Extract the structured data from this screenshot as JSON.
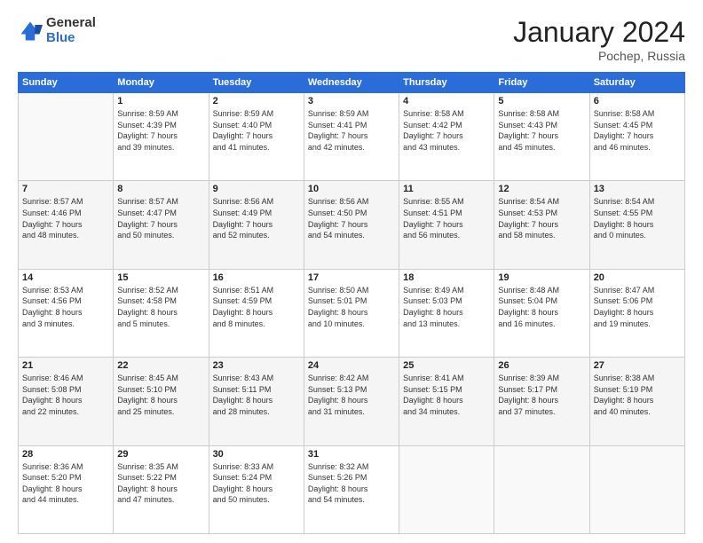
{
  "logo": {
    "general": "General",
    "blue": "Blue"
  },
  "title": {
    "month": "January 2024",
    "location": "Pochep, Russia"
  },
  "weekdays": [
    "Sunday",
    "Monday",
    "Tuesday",
    "Wednesday",
    "Thursday",
    "Friday",
    "Saturday"
  ],
  "weeks": [
    [
      {
        "day": "",
        "info": ""
      },
      {
        "day": "1",
        "info": "Sunrise: 8:59 AM\nSunset: 4:39 PM\nDaylight: 7 hours\nand 39 minutes."
      },
      {
        "day": "2",
        "info": "Sunrise: 8:59 AM\nSunset: 4:40 PM\nDaylight: 7 hours\nand 41 minutes."
      },
      {
        "day": "3",
        "info": "Sunrise: 8:59 AM\nSunset: 4:41 PM\nDaylight: 7 hours\nand 42 minutes."
      },
      {
        "day": "4",
        "info": "Sunrise: 8:58 AM\nSunset: 4:42 PM\nDaylight: 7 hours\nand 43 minutes."
      },
      {
        "day": "5",
        "info": "Sunrise: 8:58 AM\nSunset: 4:43 PM\nDaylight: 7 hours\nand 45 minutes."
      },
      {
        "day": "6",
        "info": "Sunrise: 8:58 AM\nSunset: 4:45 PM\nDaylight: 7 hours\nand 46 minutes."
      }
    ],
    [
      {
        "day": "7",
        "info": "Sunrise: 8:57 AM\nSunset: 4:46 PM\nDaylight: 7 hours\nand 48 minutes."
      },
      {
        "day": "8",
        "info": "Sunrise: 8:57 AM\nSunset: 4:47 PM\nDaylight: 7 hours\nand 50 minutes."
      },
      {
        "day": "9",
        "info": "Sunrise: 8:56 AM\nSunset: 4:49 PM\nDaylight: 7 hours\nand 52 minutes."
      },
      {
        "day": "10",
        "info": "Sunrise: 8:56 AM\nSunset: 4:50 PM\nDaylight: 7 hours\nand 54 minutes."
      },
      {
        "day": "11",
        "info": "Sunrise: 8:55 AM\nSunset: 4:51 PM\nDaylight: 7 hours\nand 56 minutes."
      },
      {
        "day": "12",
        "info": "Sunrise: 8:54 AM\nSunset: 4:53 PM\nDaylight: 7 hours\nand 58 minutes."
      },
      {
        "day": "13",
        "info": "Sunrise: 8:54 AM\nSunset: 4:55 PM\nDaylight: 8 hours\nand 0 minutes."
      }
    ],
    [
      {
        "day": "14",
        "info": "Sunrise: 8:53 AM\nSunset: 4:56 PM\nDaylight: 8 hours\nand 3 minutes."
      },
      {
        "day": "15",
        "info": "Sunrise: 8:52 AM\nSunset: 4:58 PM\nDaylight: 8 hours\nand 5 minutes."
      },
      {
        "day": "16",
        "info": "Sunrise: 8:51 AM\nSunset: 4:59 PM\nDaylight: 8 hours\nand 8 minutes."
      },
      {
        "day": "17",
        "info": "Sunrise: 8:50 AM\nSunset: 5:01 PM\nDaylight: 8 hours\nand 10 minutes."
      },
      {
        "day": "18",
        "info": "Sunrise: 8:49 AM\nSunset: 5:03 PM\nDaylight: 8 hours\nand 13 minutes."
      },
      {
        "day": "19",
        "info": "Sunrise: 8:48 AM\nSunset: 5:04 PM\nDaylight: 8 hours\nand 16 minutes."
      },
      {
        "day": "20",
        "info": "Sunrise: 8:47 AM\nSunset: 5:06 PM\nDaylight: 8 hours\nand 19 minutes."
      }
    ],
    [
      {
        "day": "21",
        "info": "Sunrise: 8:46 AM\nSunset: 5:08 PM\nDaylight: 8 hours\nand 22 minutes."
      },
      {
        "day": "22",
        "info": "Sunrise: 8:45 AM\nSunset: 5:10 PM\nDaylight: 8 hours\nand 25 minutes."
      },
      {
        "day": "23",
        "info": "Sunrise: 8:43 AM\nSunset: 5:11 PM\nDaylight: 8 hours\nand 28 minutes."
      },
      {
        "day": "24",
        "info": "Sunrise: 8:42 AM\nSunset: 5:13 PM\nDaylight: 8 hours\nand 31 minutes."
      },
      {
        "day": "25",
        "info": "Sunrise: 8:41 AM\nSunset: 5:15 PM\nDaylight: 8 hours\nand 34 minutes."
      },
      {
        "day": "26",
        "info": "Sunrise: 8:39 AM\nSunset: 5:17 PM\nDaylight: 8 hours\nand 37 minutes."
      },
      {
        "day": "27",
        "info": "Sunrise: 8:38 AM\nSunset: 5:19 PM\nDaylight: 8 hours\nand 40 minutes."
      }
    ],
    [
      {
        "day": "28",
        "info": "Sunrise: 8:36 AM\nSunset: 5:20 PM\nDaylight: 8 hours\nand 44 minutes."
      },
      {
        "day": "29",
        "info": "Sunrise: 8:35 AM\nSunset: 5:22 PM\nDaylight: 8 hours\nand 47 minutes."
      },
      {
        "day": "30",
        "info": "Sunrise: 8:33 AM\nSunset: 5:24 PM\nDaylight: 8 hours\nand 50 minutes."
      },
      {
        "day": "31",
        "info": "Sunrise: 8:32 AM\nSunset: 5:26 PM\nDaylight: 8 hours\nand 54 minutes."
      },
      {
        "day": "",
        "info": ""
      },
      {
        "day": "",
        "info": ""
      },
      {
        "day": "",
        "info": ""
      }
    ]
  ]
}
